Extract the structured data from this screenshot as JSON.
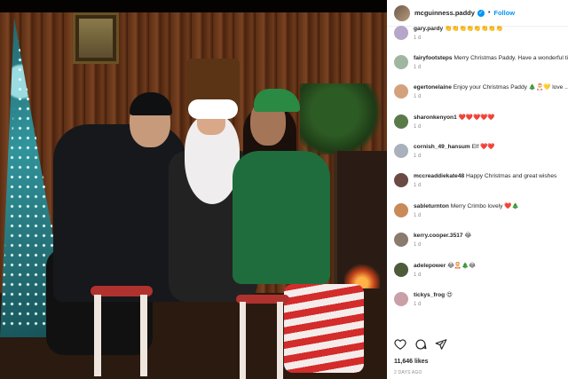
{
  "post": {
    "username": "mcguinness.paddy",
    "follow_label": "Follow",
    "likes": "11,646 likes",
    "time": "2 DAYS AGO"
  },
  "comments": [
    {
      "user": "gary.pardy",
      "text": "👏👏👏👏👏👏👏👏",
      "time": "1 d",
      "avatar_color": "#b6a6c9"
    },
    {
      "user": "fairyfootsteps",
      "text": "Merry Christmas Paddy. Have a wonderful time with your children x",
      "time": "1 d",
      "avatar_color": "#9fb6a0"
    },
    {
      "user": "egertonelaine",
      "text": "Enjoy your Christmas Paddy 🎄🎅💛 love ...x",
      "time": "1 d",
      "avatar_color": "#d3a27d"
    },
    {
      "user": "sharonkenyon1",
      "text": "❤️❤️❤️❤️❤️",
      "time": "1 d",
      "avatar_color": "#5a7a4a"
    },
    {
      "user": "cornish_49_hansum",
      "text": "Elf ❤️❤️",
      "time": "1 d",
      "avatar_color": "#a9b1bd"
    },
    {
      "user": "mccreaddiekate48",
      "text": "Happy Christmas and great wishes",
      "time": "1 d",
      "avatar_color": "#6b4a46"
    },
    {
      "user": "sableturnton",
      "text": "Merry Crimbo lovely ❤️🎄",
      "time": "1 d",
      "avatar_color": "#c98a5a"
    },
    {
      "user": "kerry.cooper.3517",
      "text": "😂",
      "time": "1 d",
      "avatar_color": "#8a7b6f"
    },
    {
      "user": "adelepower",
      "text": "😂🤶🎄😂",
      "time": "1 d",
      "avatar_color": "#4d5b3a"
    },
    {
      "user": "tickys_frog",
      "text": "😍",
      "time": "1 d",
      "avatar_color": "#c9a0a8"
    }
  ]
}
